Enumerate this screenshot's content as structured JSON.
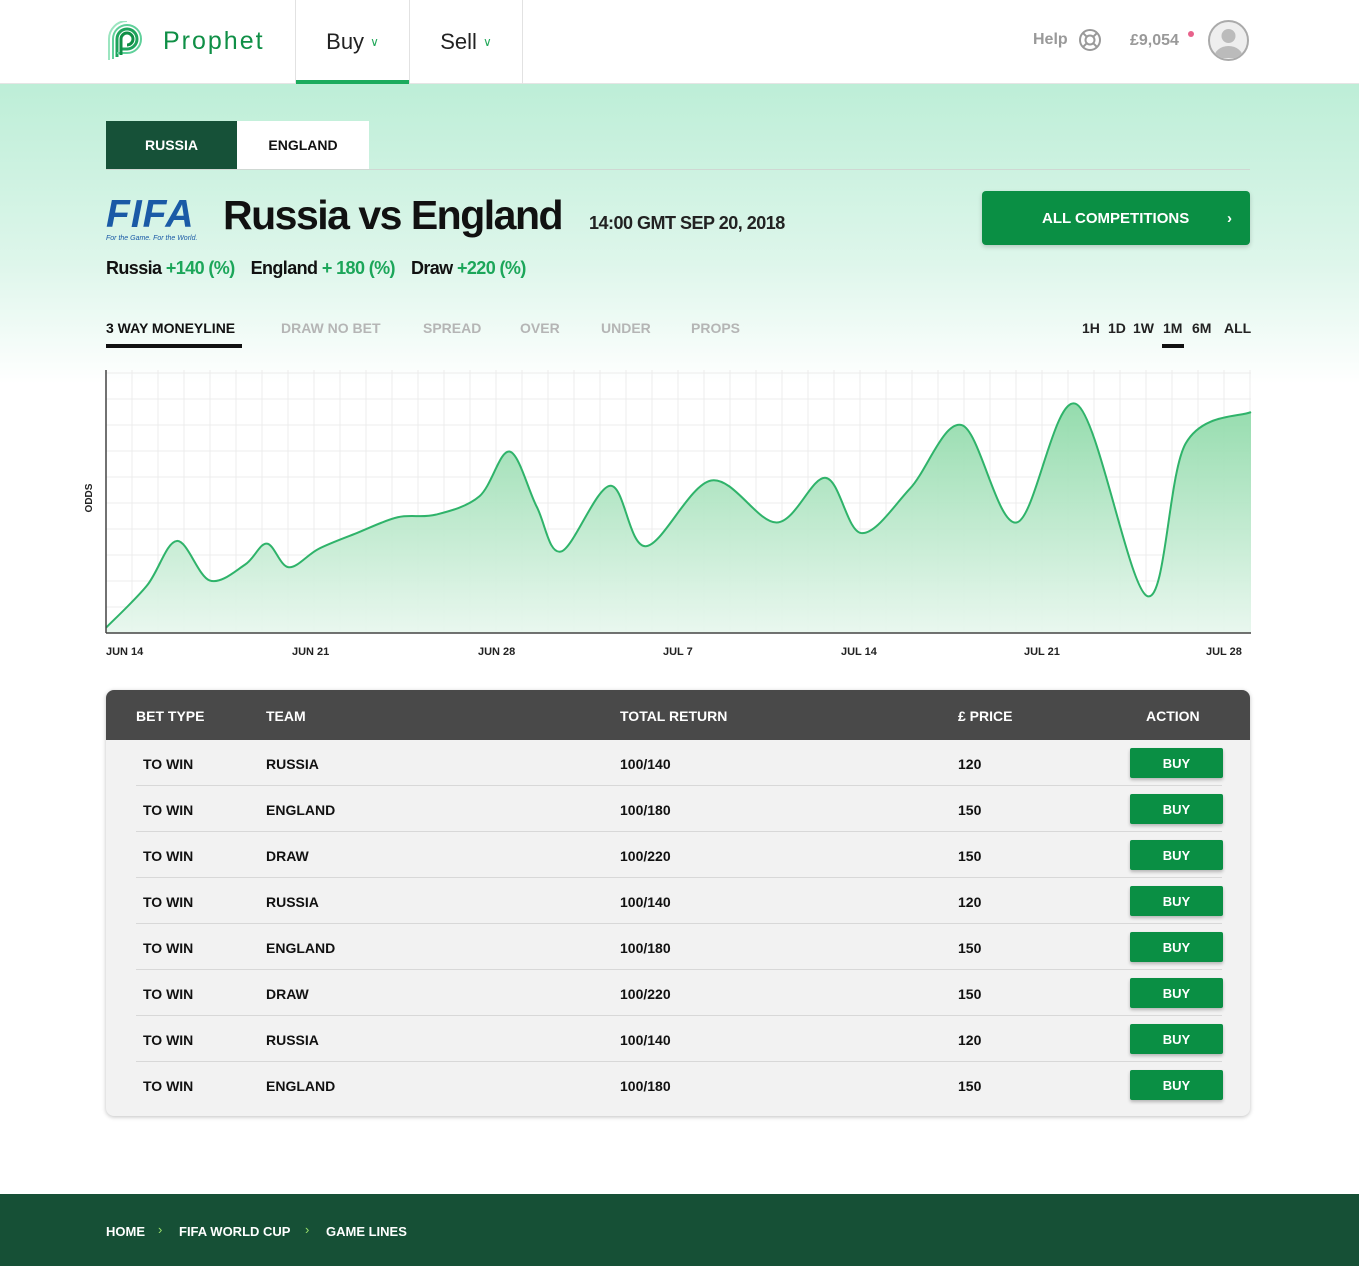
{
  "header": {
    "brand": "Prophet",
    "nav": [
      {
        "label": "Buy"
      },
      {
        "label": "Sell"
      }
    ],
    "help_label": "Help",
    "balance": "£9,054"
  },
  "team_tabs": [
    "RUSSIA",
    "ENGLAND"
  ],
  "match": {
    "logo_text": "FIFA",
    "logo_tagline": "For the Game. For the World.",
    "title": "Russia vs England",
    "time": "14:00 GMT SEP 20, 2018",
    "all_competitions_label": "ALL COMPETITIONS",
    "odds": [
      {
        "team": "Russia",
        "value": "+140 (%)"
      },
      {
        "team": "England",
        "value": "+ 180 (%)"
      },
      {
        "team": "Draw",
        "value": "+220 (%)"
      }
    ]
  },
  "market_tabs": [
    "3 WAY MONEYLINE",
    "DRAW NO BET",
    "SPREAD",
    "OVER",
    "UNDER",
    "PROPS"
  ],
  "range_tabs": [
    "1H",
    "1D",
    "1W",
    "1M",
    "6M",
    "ALL"
  ],
  "colors": {
    "accent": "#0a8f44",
    "dark_green": "#165138",
    "line": "#2fb36a"
  },
  "chart_data": {
    "type": "area",
    "ylabel": "ODDS",
    "xlabel": "",
    "x_ticks": [
      "JUN 14",
      "JUN 21",
      "JUN 28",
      "JUL 7",
      "JUL 14",
      "JUL 21",
      "JUL 28"
    ],
    "grid": true,
    "ylim": [
      0,
      100
    ],
    "points": [
      [
        0,
        2
      ],
      [
        1.5,
        18
      ],
      [
        2.6,
        35
      ],
      [
        3.8,
        20
      ],
      [
        5.1,
        26
      ],
      [
        5.9,
        34
      ],
      [
        6.7,
        25
      ],
      [
        7.8,
        32
      ],
      [
        9.2,
        38
      ],
      [
        10.7,
        44
      ],
      [
        12.1,
        45
      ],
      [
        13.7,
        52
      ],
      [
        14.8,
        69
      ],
      [
        15.8,
        48
      ],
      [
        16.7,
        31
      ],
      [
        18.5,
        56
      ],
      [
        19.8,
        33
      ],
      [
        22.2,
        58
      ],
      [
        24.6,
        42
      ],
      [
        26.4,
        59
      ],
      [
        27.7,
        38
      ],
      [
        29.5,
        55
      ],
      [
        31.4,
        79
      ],
      [
        33.4,
        42
      ],
      [
        35.6,
        87
      ],
      [
        38.2,
        14
      ],
      [
        39.6,
        72
      ],
      [
        42,
        84
      ]
    ]
  },
  "table": {
    "headers": [
      "BET TYPE",
      "TEAM",
      "TOTAL RETURN",
      "£ PRICE",
      "ACTION"
    ],
    "rows": [
      {
        "type": "TO WIN",
        "team": "RUSSIA",
        "ret": "100/140",
        "price": "120",
        "action": "BUY"
      },
      {
        "type": "TO WIN",
        "team": "ENGLAND",
        "ret": "100/180",
        "price": "150",
        "action": "BUY"
      },
      {
        "type": "TO WIN",
        "team": "DRAW",
        "ret": "100/220",
        "price": "150",
        "action": "BUY"
      },
      {
        "type": "TO WIN",
        "team": "RUSSIA",
        "ret": "100/140",
        "price": "120",
        "action": "BUY"
      },
      {
        "type": "TO WIN",
        "team": "ENGLAND",
        "ret": "100/180",
        "price": "150",
        "action": "BUY"
      },
      {
        "type": "TO WIN",
        "team": "DRAW",
        "ret": "100/220",
        "price": "150",
        "action": "BUY"
      },
      {
        "type": "TO WIN",
        "team": "RUSSIA",
        "ret": "100/140",
        "price": "120",
        "action": "BUY"
      },
      {
        "type": "TO WIN",
        "team": "ENGLAND",
        "ret": "100/180",
        "price": "150",
        "action": "BUY"
      }
    ]
  },
  "breadcrumb": [
    "HOME",
    "FIFA WORLD CUP",
    "GAME LINES"
  ]
}
